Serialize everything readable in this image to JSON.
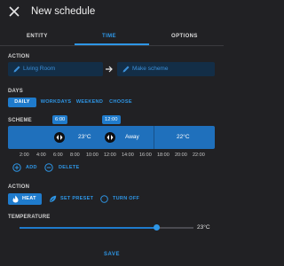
{
  "header": {
    "title": "New schedule",
    "close_icon": "close-icon"
  },
  "tabs": [
    {
      "label": "ENTITY",
      "active": false
    },
    {
      "label": "TIME",
      "active": true
    },
    {
      "label": "OPTIONS",
      "active": false
    }
  ],
  "action_section": {
    "label": "ACTION",
    "source": {
      "icon": "pencil-icon",
      "text": "Living Room"
    },
    "arrow_icon": "arrow-right-icon",
    "target": {
      "icon": "pencil-icon",
      "text": "Make scheme"
    }
  },
  "days": {
    "label": "DAYS",
    "options": [
      {
        "label": "DAILY",
        "active": true
      },
      {
        "label": "WORKDAYS",
        "active": false
      },
      {
        "label": "WEEKEND",
        "active": false
      },
      {
        "label": "CHOOSE",
        "active": false
      }
    ]
  },
  "scheme": {
    "label": "SCHEME",
    "handles": [
      "6:00",
      "12:00"
    ],
    "segments": [
      {
        "label": "23°C",
        "start": "00:00",
        "end": "06:00"
      },
      {
        "label": "23°C",
        "start": "06:00",
        "end": "12:00"
      },
      {
        "label": "Away",
        "start": "12:00",
        "end": "17:00"
      },
      {
        "label": "22°C",
        "start": "17:00",
        "end": "24:00"
      }
    ],
    "ticks": [
      "2:00",
      "4:00",
      "6:00",
      "8:00",
      "10:00",
      "12:00",
      "14:00",
      "16:00",
      "18:00",
      "20:00",
      "22:00"
    ],
    "add_label": "ADD",
    "delete_label": "DELETE"
  },
  "action_mode": {
    "label": "ACTION",
    "options": [
      {
        "label": "HEAT",
        "icon": "flame-icon",
        "active": true
      },
      {
        "label": "SET PRESET",
        "icon": "leaf-icon",
        "active": false
      },
      {
        "label": "TURN OFF",
        "icon": "power-icon",
        "active": false
      }
    ]
  },
  "temperature": {
    "label": "TEMPERATURE",
    "value": "23°C",
    "level_percent": 79
  },
  "footer": {
    "save_label": "SAVE"
  },
  "colors": {
    "accent": "#2e96e6",
    "bar": "#1f70bc",
    "background": "#212124"
  }
}
